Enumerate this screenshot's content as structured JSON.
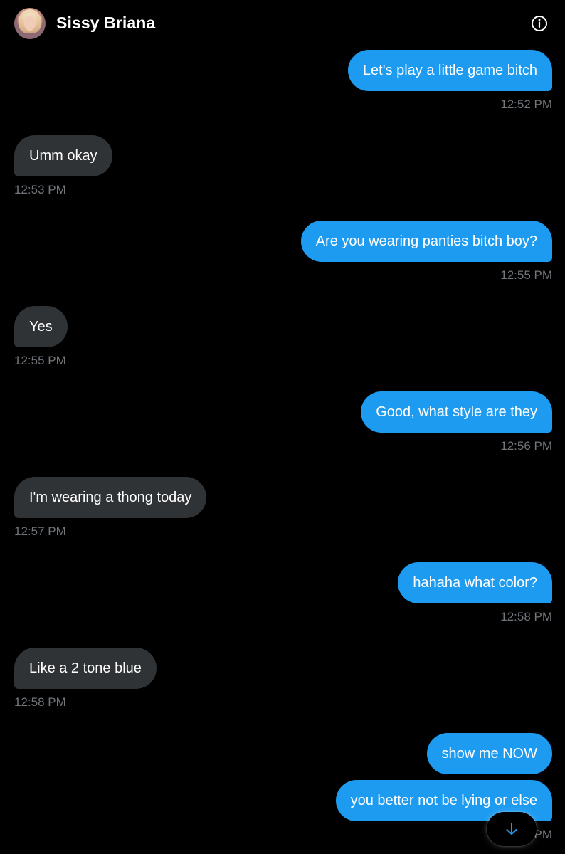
{
  "header": {
    "contact_name": "Sissy Briana",
    "avatar_icon": "profile-avatar",
    "info_icon": "info-icon"
  },
  "messages": [
    {
      "direction": "outgoing",
      "text": "Let's play a little game bitch",
      "time": "12:52 PM"
    },
    {
      "direction": "incoming",
      "text": "Umm okay",
      "time": "12:53 PM"
    },
    {
      "direction": "outgoing",
      "text": "Are you wearing panties bitch boy?",
      "time": "12:55 PM"
    },
    {
      "direction": "incoming",
      "text": "Yes",
      "time": "12:55 PM"
    },
    {
      "direction": "outgoing",
      "text": "Good, what style are they",
      "time": "12:56 PM"
    },
    {
      "direction": "incoming",
      "text": "I'm wearing a thong today",
      "time": "12:57 PM"
    },
    {
      "direction": "outgoing",
      "text": "hahaha what color?",
      "time": "12:58 PM"
    },
    {
      "direction": "incoming",
      "text": "Like a 2 tone blue",
      "time": "12:58 PM"
    },
    {
      "direction": "outgoing",
      "text": "show me NOW",
      "time": ""
    },
    {
      "direction": "outgoing",
      "text": "you better not be lying or else",
      "time": "PM"
    }
  ],
  "scroll_button": {
    "icon": "arrow-down-icon"
  },
  "colors": {
    "background": "#000000",
    "outgoing_bubble": "#1d9bf0",
    "incoming_bubble": "#2f3336",
    "timestamp": "#71767b"
  }
}
